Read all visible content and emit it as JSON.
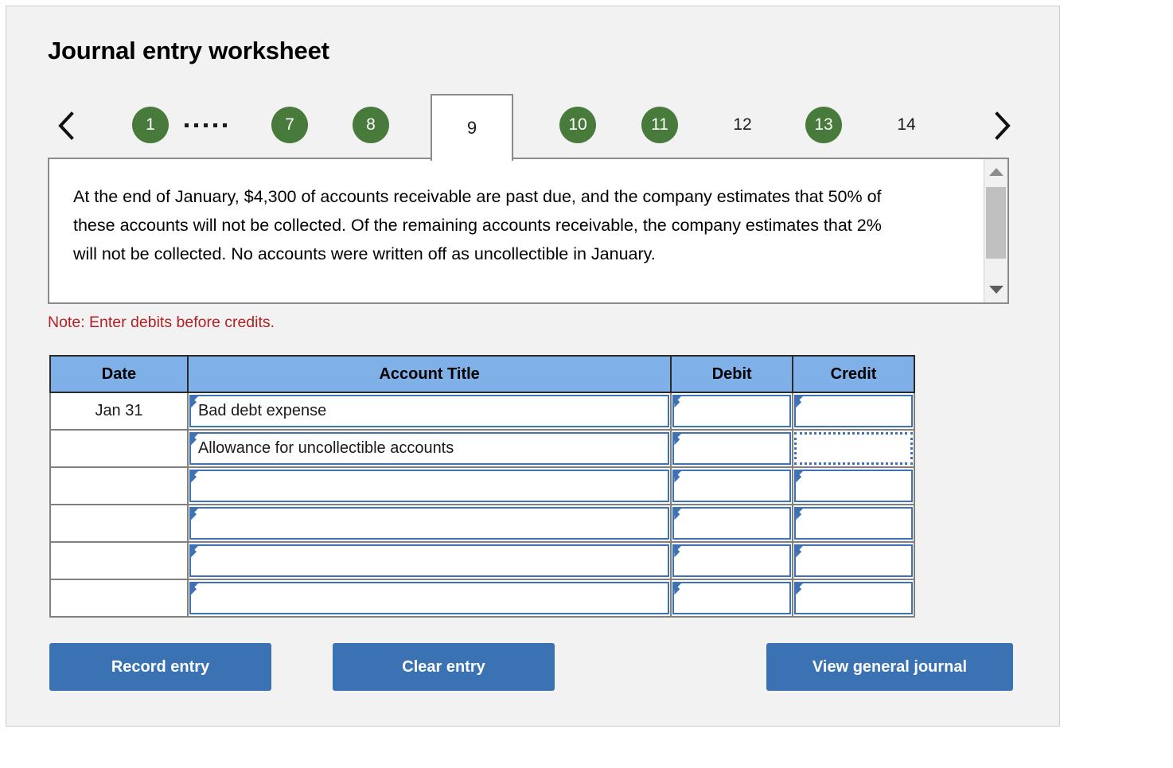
{
  "page_title": "Journal entry worksheet",
  "tabs": {
    "prev_arrow": "chevron-left",
    "next_arrow": "chevron-right",
    "items": [
      {
        "label": "1",
        "state": "complete"
      },
      {
        "label": "…",
        "state": "ellipsis"
      },
      {
        "label": "7",
        "state": "complete"
      },
      {
        "label": "8",
        "state": "complete"
      },
      {
        "label": "9",
        "state": "active"
      },
      {
        "label": "10",
        "state": "complete"
      },
      {
        "label": "11",
        "state": "complete"
      },
      {
        "label": "12",
        "state": "plain"
      },
      {
        "label": "13",
        "state": "complete"
      },
      {
        "label": "14",
        "state": "plain"
      }
    ],
    "active_label": "9",
    "complete_color": "#487a3c"
  },
  "question": {
    "text": "At the end of January, $4,300 of accounts receivable are past due, and the company estimates that 50% of these accounts will not be collected. Of the remaining accounts receivable, the company estimates that 2% will not be collected. No accounts were written off as uncollectible in January.",
    "scrollbar": {
      "up_icon": "triangle-up-icon",
      "down_icon": "triangle-down-icon"
    }
  },
  "note": "Note: Enter debits before credits.",
  "note_color": "#b32025",
  "table": {
    "headers": [
      "Date",
      "Account Title",
      "Debit",
      "Credit"
    ],
    "header_bg": "#7fb0e8",
    "rows": [
      {
        "date": "Jan 31",
        "account": "Bad debt expense",
        "debit": "",
        "credit": "",
        "selected": ""
      },
      {
        "date": "",
        "account": "Allowance for uncollectible accounts",
        "debit": "",
        "credit": "",
        "selected": "credit"
      },
      {
        "date": "",
        "account": "",
        "debit": "",
        "credit": "",
        "selected": ""
      },
      {
        "date": "",
        "account": "",
        "debit": "",
        "credit": "",
        "selected": ""
      },
      {
        "date": "",
        "account": "",
        "debit": "",
        "credit": "",
        "selected": ""
      },
      {
        "date": "",
        "account": "",
        "debit": "",
        "credit": "",
        "selected": ""
      }
    ]
  },
  "buttons": {
    "record": "Record entry",
    "clear": "Clear entry",
    "view": "View general journal",
    "color": "#3a72b4"
  }
}
